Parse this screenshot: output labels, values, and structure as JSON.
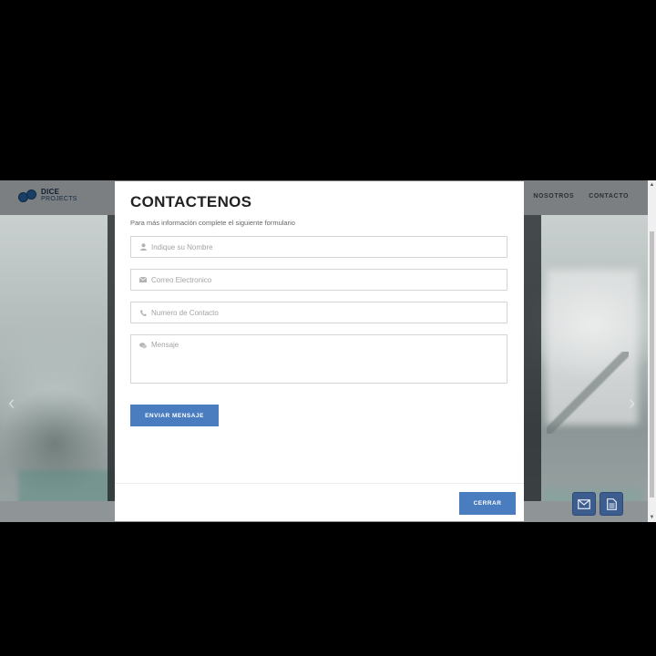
{
  "site": {
    "logo": {
      "line1": "DICE",
      "line2": "PROJECTS",
      "tagline": ""
    },
    "nav": [
      {
        "label": "NOSOTROS"
      },
      {
        "label": "CONTACTO"
      }
    ],
    "arrows": {
      "left": "‹",
      "right": "›"
    },
    "floating_buttons": [
      {
        "icon": "mail-icon"
      },
      {
        "icon": "document-icon"
      }
    ],
    "scrollbar": {
      "up": "▲",
      "down": "▼"
    }
  },
  "modal": {
    "title": "CONTACTENOS",
    "subtitle": "Para más información complete el siguiente formulario",
    "fields": {
      "nombre": {
        "placeholder": "Indique su Nombre",
        "icon": "user-icon",
        "value": ""
      },
      "correo": {
        "placeholder": "Correo Electronico",
        "icon": "envelope-icon",
        "value": ""
      },
      "telefono": {
        "placeholder": "Numero de Contacto",
        "icon": "phone-icon",
        "value": ""
      },
      "mensaje": {
        "placeholder": "Mensaje",
        "icon": "comment-icon",
        "value": ""
      }
    },
    "send_label": "ENVIAR MENSAJE",
    "close_label": "CERRAR"
  },
  "colors": {
    "accent": "#4a7cc0",
    "fab": "#3c5d8e",
    "overlay": "#000000"
  }
}
